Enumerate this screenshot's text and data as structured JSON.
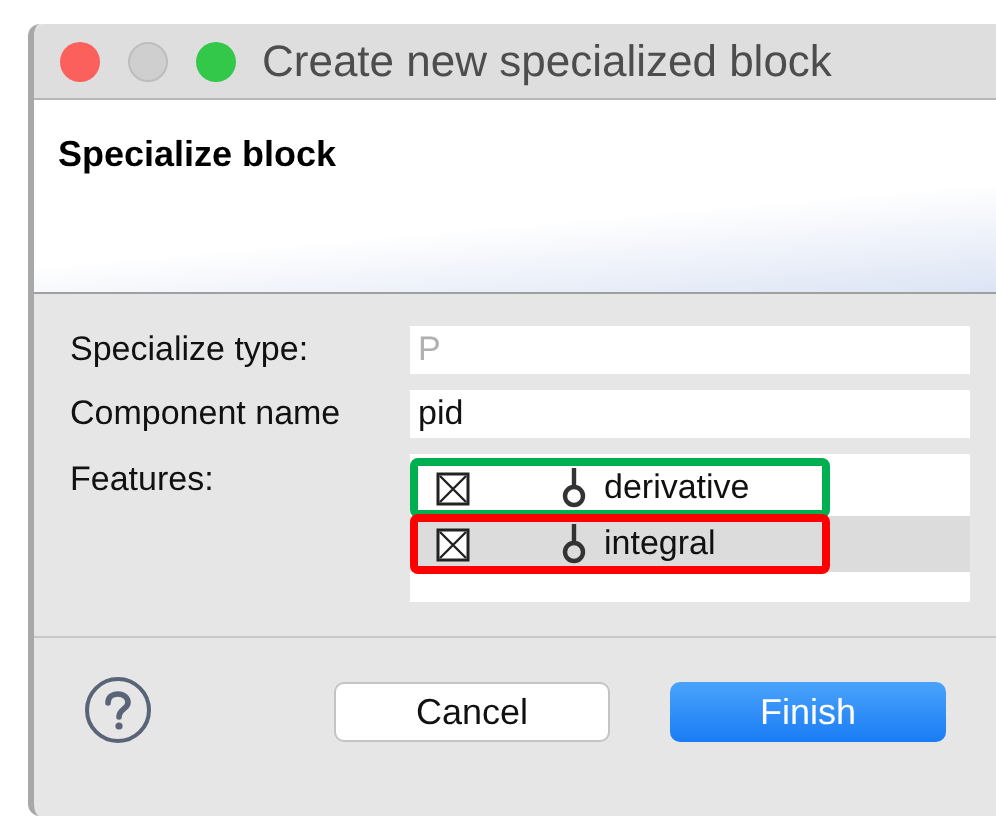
{
  "window": {
    "title": "Create new specialized block"
  },
  "header": {
    "title": "Specialize block"
  },
  "form": {
    "specialize_type": {
      "label": "Specialize type:",
      "placeholder": "P"
    },
    "component_name": {
      "label": "Component name",
      "value": "pid"
    },
    "features": {
      "label": "Features:",
      "items": [
        {
          "label": "derivative",
          "checked": true,
          "selected": false,
          "color": "#00b050"
        },
        {
          "label": "integral",
          "checked": true,
          "selected": true,
          "color": "#ff0000"
        }
      ]
    }
  },
  "buttons": [
    {
      "label": "Cancel",
      "kind": "secondary"
    },
    {
      "label": "Finish",
      "kind": "primary"
    }
  ]
}
